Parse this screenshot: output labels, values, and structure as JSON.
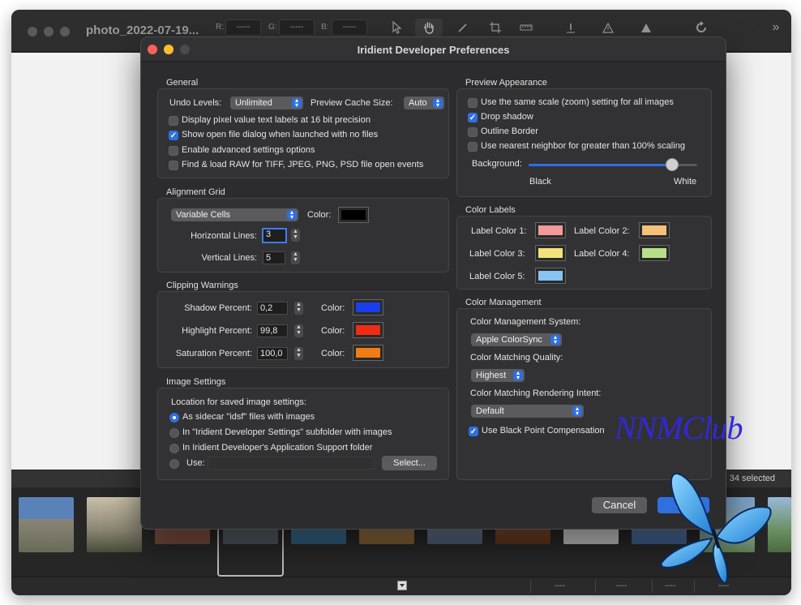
{
  "main_window": {
    "doc_title": "photo_2022-07-19...",
    "rgb": [
      {
        "label": "R:",
        "value": "-----"
      },
      {
        "label": "G:",
        "value": "-----"
      },
      {
        "label": "B:",
        "value": "-----"
      }
    ],
    "tool_icons": [
      "arrow-pointer-icon",
      "hand-icon",
      "pen-icon",
      "crop-icon",
      "ruler-icon",
      "warning-dark-icon",
      "warning-icon",
      "triangle-icon",
      "rotate-icon"
    ],
    "filmstrip_status": "34 selected",
    "status_fields": [
      "----",
      "----",
      "----",
      "----"
    ],
    "thumb_colors": [
      "#6a7d88",
      "#8a8573",
      "#a06050",
      "#5e6772",
      "#4d86a8",
      "#a08050",
      "#6d7c8e",
      "#8a5535",
      "#d8d8d8",
      "#5b7fb0",
      "#6f88a0",
      "#9ab0c0",
      "#6a9060"
    ]
  },
  "prefs": {
    "title": "Iridient Developer Preferences",
    "general": {
      "title": "General",
      "undo_label": "Undo Levels:",
      "undo_value": "Unlimited",
      "cache_label": "Preview Cache Size:",
      "cache_value": "Auto",
      "checkboxes": [
        {
          "label": "Display pixel value text labels at 16 bit precision",
          "checked": false
        },
        {
          "label": "Show open file dialog when launched with no files",
          "checked": true
        },
        {
          "label": "Enable advanced settings options",
          "checked": false
        },
        {
          "label": "Find & load RAW for TIFF, JPEG, PNG, PSD file open events",
          "checked": false
        }
      ]
    },
    "alignment_grid": {
      "title": "Alignment Grid",
      "mode": "Variable Cells",
      "color_label": "Color:",
      "color": "#000000",
      "horizontal_label": "Horizontal Lines:",
      "horizontal_value": "3",
      "vertical_label": "Vertical Lines:",
      "vertical_value": "5"
    },
    "clipping_warnings": {
      "title": "Clipping Warnings",
      "color_label": "Color:",
      "rows": [
        {
          "label": "Shadow Percent:",
          "value": "0,2",
          "color": "#1a3ee8"
        },
        {
          "label": "Highlight Percent:",
          "value": "99,8",
          "color": "#f02c14"
        },
        {
          "label": "Saturation Percent:",
          "value": "100,0",
          "color": "#f07c14"
        }
      ]
    },
    "image_settings": {
      "title": "Image Settings",
      "location_label": "Location for saved image settings:",
      "options": [
        {
          "label": "As sidecar \"idsf\" files with images",
          "selected": true
        },
        {
          "label": "In \"Iridient Developer Settings\" subfolder with images",
          "selected": false
        },
        {
          "label": "In Iridient Developer's Application Support folder",
          "selected": false
        },
        {
          "label": "Use:",
          "selected": false
        }
      ],
      "use_path": "",
      "select_button": "Select..."
    },
    "preview_appearance": {
      "title": "Preview Appearance",
      "checkboxes": [
        {
          "label": "Use the same scale (zoom) setting for all images",
          "checked": false
        },
        {
          "label": "Drop shadow",
          "checked": true
        },
        {
          "label": "Outline Border",
          "checked": false
        },
        {
          "label": "Use nearest neighbor for greater than 100% scaling",
          "checked": false
        }
      ],
      "background_label": "Background:",
      "slider_min": "Black",
      "slider_max": "White",
      "background_level": 0.85
    },
    "color_labels": {
      "title": "Color Labels",
      "labels": [
        {
          "label": "Label Color 1:",
          "color": "#f29a9a"
        },
        {
          "label": "Label Color 2:",
          "color": "#f6c07a"
        },
        {
          "label": "Label Color 3:",
          "color": "#f2e27c"
        },
        {
          "label": "Label Color 4:",
          "color": "#b8e08a"
        },
        {
          "label": "Label Color 5:",
          "color": "#86c4f2"
        }
      ]
    },
    "color_management": {
      "title": "Color Management",
      "system_label": "Color Management System:",
      "system_value": "Apple ColorSync",
      "quality_label": "Color Matching Quality:",
      "quality_value": "Highest",
      "intent_label": "Color Matching Rendering Intent:",
      "intent_value": "Default",
      "bpc_label": "Use Black Point Compensation",
      "bpc_checked": true
    },
    "buttons": {
      "cancel": "Cancel",
      "ok": "OK"
    }
  },
  "watermark": {
    "text": "NNMClub"
  }
}
